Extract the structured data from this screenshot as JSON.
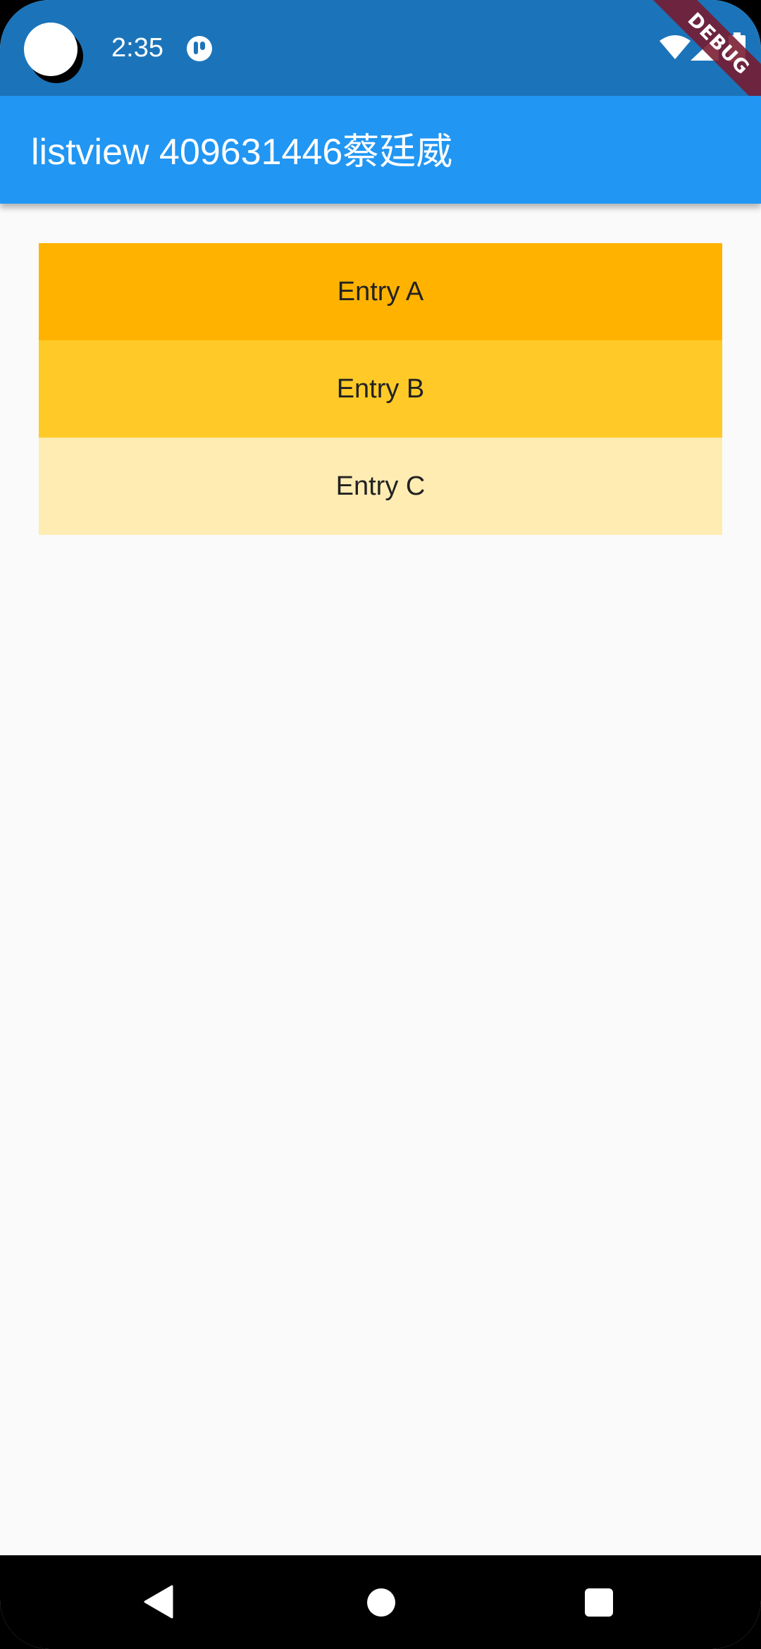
{
  "status_bar": {
    "time": "2:35",
    "icons": [
      "camera-cutout",
      "notification-icon",
      "wifi-icon",
      "signal-icon",
      "battery-icon"
    ],
    "background": "#1b74ba"
  },
  "debug_banner": {
    "label": "DEBUG",
    "color": "#78192d"
  },
  "app_bar": {
    "title": "listview 409631446蔡廷威",
    "background": "#2196f3"
  },
  "list": {
    "items": [
      {
        "label": "Entry A",
        "color": "#ffb300"
      },
      {
        "label": "Entry B",
        "color": "#ffca28"
      },
      {
        "label": "Entry C",
        "color": "#ffecb3"
      }
    ]
  },
  "nav_bar": {
    "buttons": [
      "back-icon",
      "home-icon",
      "recents-icon"
    ]
  }
}
